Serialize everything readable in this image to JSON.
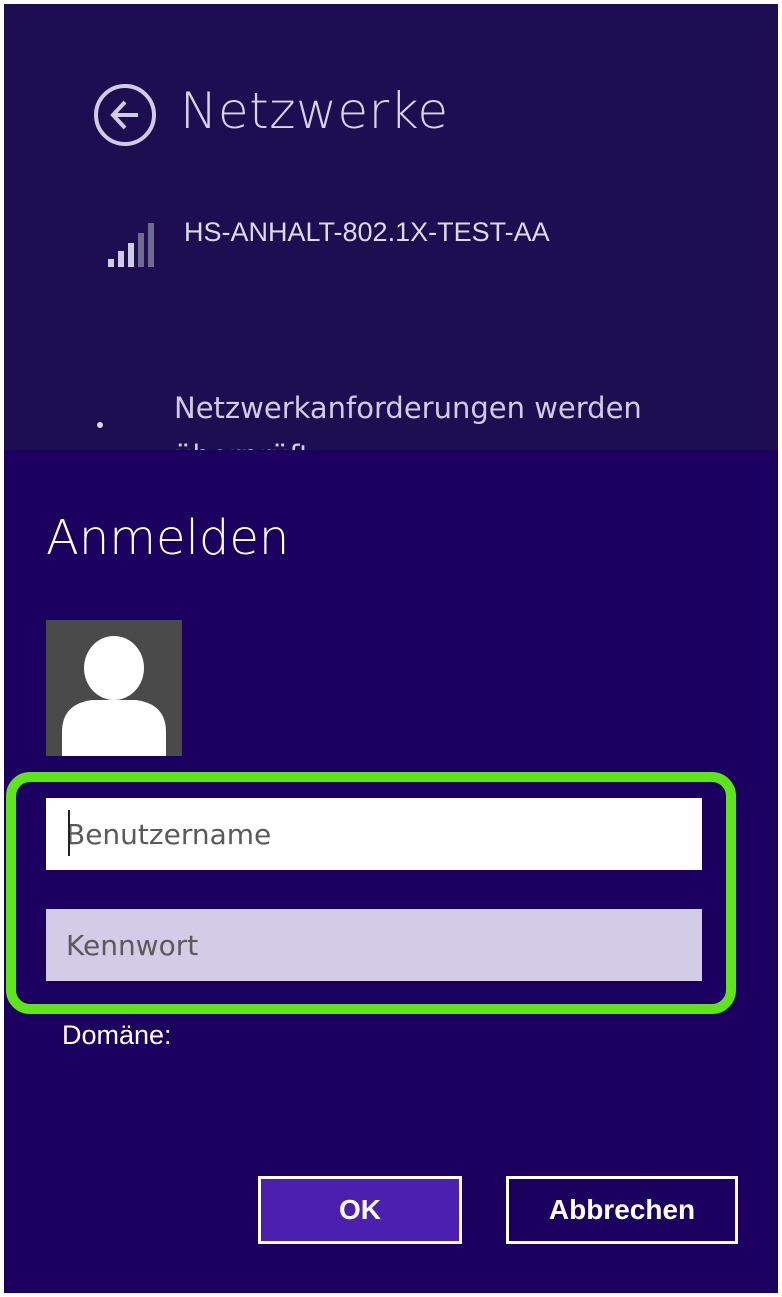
{
  "networks_pane": {
    "heading": "Netzwerke",
    "network_name": "HS-ANHALT-802.1X-TEST-AA",
    "status_text": "Netzwerkanforderungen werden überprüft"
  },
  "sign_in_dialog": {
    "title": "Anmelden",
    "username_placeholder": "Benutzername",
    "password_placeholder": "Kennwort",
    "domain_label": "Domäne:",
    "ok_label": "OK",
    "cancel_label": "Abbrechen"
  },
  "colors": {
    "networks_background": "#1c0e50",
    "dialog_background": "#1b005f",
    "ok_button": "#4b1fb0",
    "highlight": "#5ee51a",
    "password_field": "#d3cce6"
  },
  "icons": {
    "back": "back-arrow-icon",
    "signal": "wifi-signal-icon",
    "avatar": "user-avatar-icon"
  }
}
